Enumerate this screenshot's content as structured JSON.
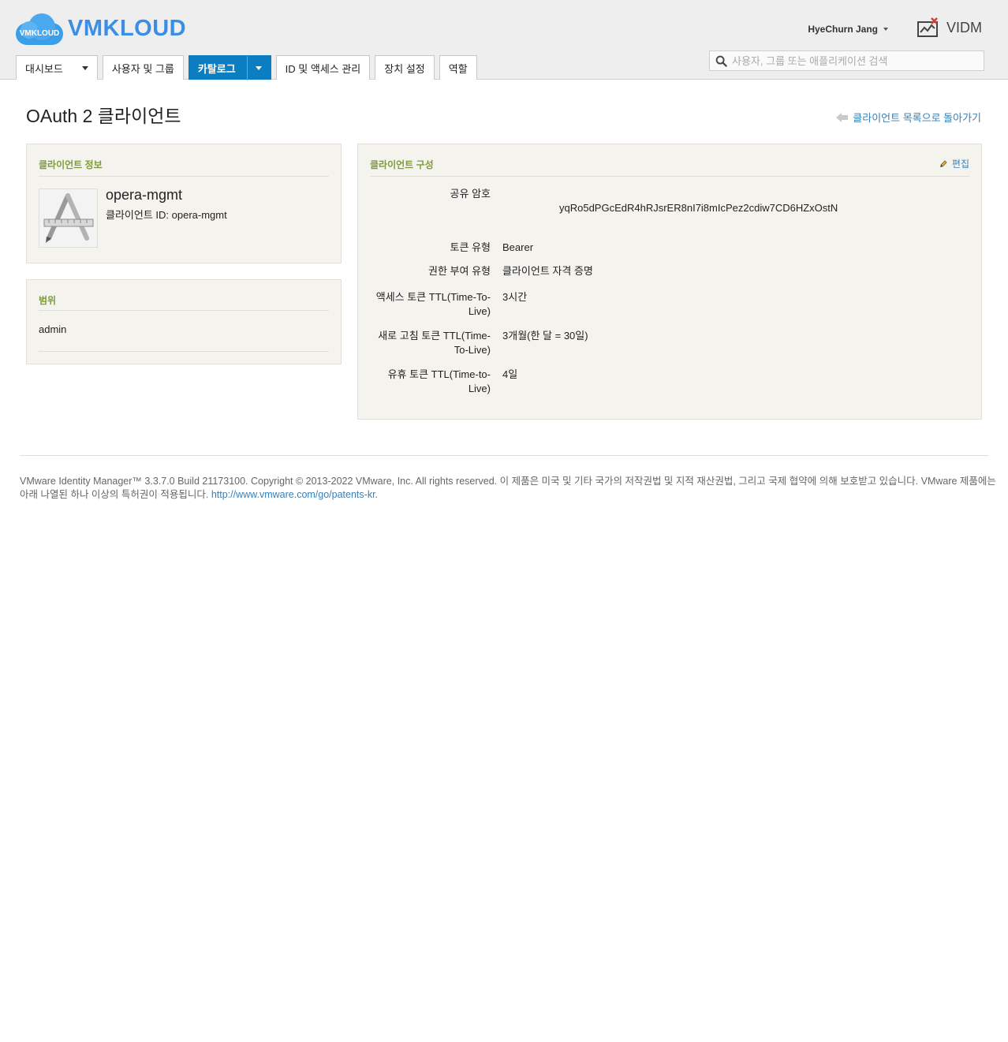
{
  "brand": {
    "logo_label": "VMKLOUD",
    "name": "VMKLOUD"
  },
  "header": {
    "user_name": "HyeChurn Jang",
    "app_name": "VIDM",
    "search_placeholder": "사용자, 그룹 또는 애플리케이션 검색"
  },
  "tabs": [
    {
      "label": "대시보드"
    },
    {
      "label": "사용자 및 그룹"
    },
    {
      "label": "카탈로그"
    },
    {
      "label": "ID 및 액세스 관리"
    },
    {
      "label": "장치 설정"
    },
    {
      "label": "역할"
    }
  ],
  "page": {
    "title": "OAuth 2 클라이언트",
    "back_link": "클라이언트 목록으로 돌아가기"
  },
  "client_info": {
    "heading": "클라이언트 정보",
    "name": "opera-mgmt",
    "id_line": "클라이언트 ID: opera-mgmt"
  },
  "scope": {
    "heading": "범위",
    "items": [
      "admin"
    ]
  },
  "config": {
    "heading": "클라이언트 구성",
    "edit_label": "편집",
    "secret_label": "공유 암호",
    "secret_value": "yqRo5dPGcEdR4hRJsrER8nI7i8mIcPez2cdiw7CD6HZxOstN",
    "rows": [
      {
        "label": "토큰 유형",
        "value": "Bearer"
      },
      {
        "label": "권한 부여 유형",
        "value": "클라이언트 자격 증명"
      },
      {
        "label": "액세스 토큰 TTL(Time-To-Live)",
        "value": "3시간"
      },
      {
        "label": "새로 고침 토큰 TTL(Time-To-Live)",
        "value": "3개월(한 달 = 30일)"
      },
      {
        "label": "유휴 토큰 TTL(Time-to-Live)",
        "value": "4일"
      }
    ]
  },
  "footer": {
    "text": "VMware Identity Manager™ 3.3.7.0 Build 21173100. Copyright © 2013-2022 VMware, Inc. All rights reserved. 이 제품은 미국 및 기타 국가의 저작권법 및 지적 재산권법, 그리고 국제 협약에 의해 보호받고 있습니다. VMware 제품에는 아래 나열된 하나 이상의 특허권이 적용됩니다.",
    "link": "http://www.vmware.com/go/patents-kr",
    "link_suffix": "."
  },
  "colors": {
    "active_tab": "#0b7ec1",
    "panel_heading": "#7d9b3c",
    "link": "#3a7fb5",
    "brand": "#3a8ee6"
  }
}
